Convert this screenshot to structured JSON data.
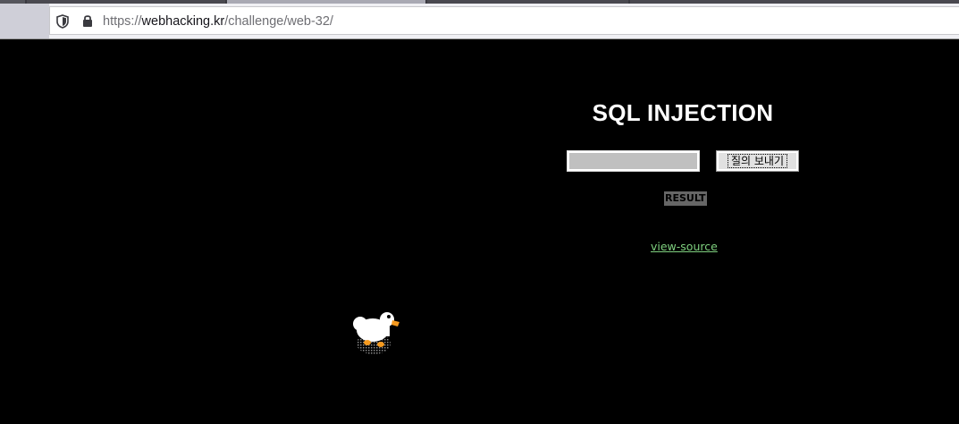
{
  "browser": {
    "url_scheme": "https://",
    "url_host": "webhacking.kr",
    "url_path": "/challenge/web-32/",
    "icons": [
      "shield-icon",
      "lock-icon"
    ]
  },
  "page": {
    "title": "SQL INJECTION",
    "query_input_value": "",
    "submit_label": "질의 보내기",
    "result_label": "RESULT",
    "view_source_label": "view-source",
    "mascot": "duck-icon"
  },
  "colors": {
    "background": "#000000",
    "title": "#ffffff",
    "link": "#7fd17f",
    "result_bg": "#666666"
  }
}
